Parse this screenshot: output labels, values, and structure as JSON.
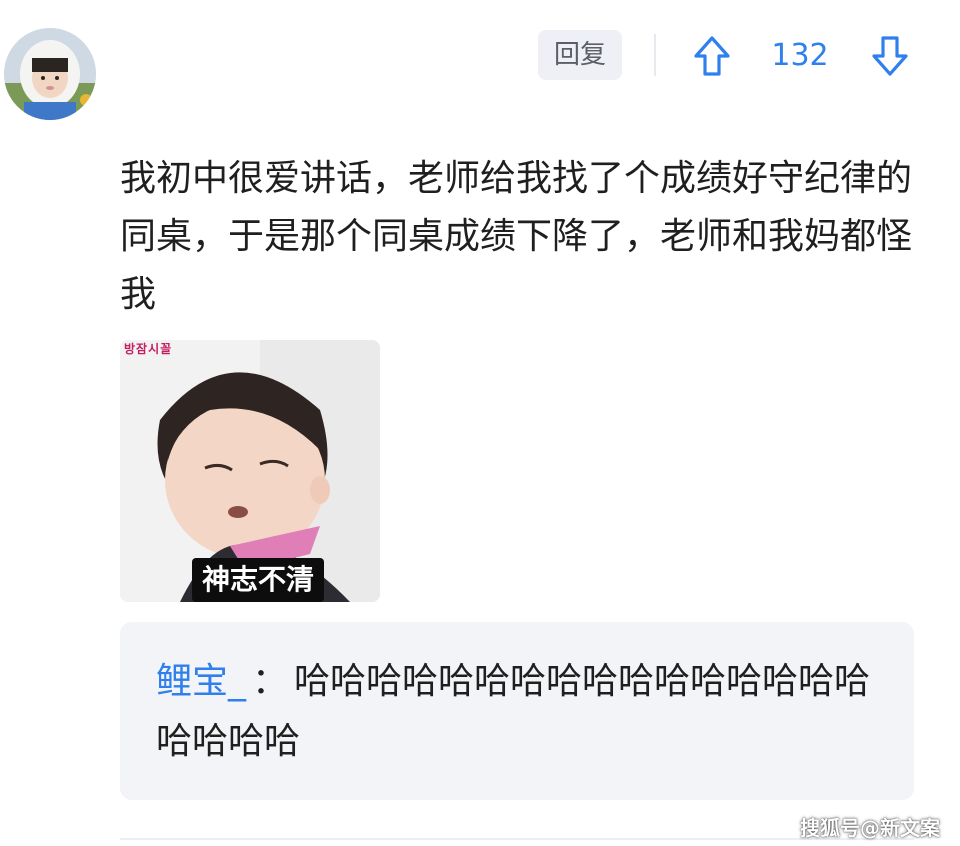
{
  "comment": {
    "actions": {
      "reply_label": "回复",
      "vote_count": "132"
    },
    "text": "我初中很爱讲话，老师给我找了个成绩好守纪律的同桌，于是那个同桌成绩下降了，老师和我妈都怪我",
    "meme": {
      "tag": "방잠시꼴",
      "caption": "神志不清"
    }
  },
  "reply": {
    "username": "鲤宝_",
    "separator": "：",
    "text": "哈哈哈哈哈哈哈哈哈哈哈哈哈哈哈哈哈哈哈哈"
  },
  "watermark": "搜狐号@新文案",
  "icons": {
    "upvote": "arrow-up-icon",
    "downvote": "arrow-down-icon",
    "avatar": "user-avatar"
  },
  "colors": {
    "accent": "#2f80ed",
    "reply_box_bg": "#f3f4f7",
    "reply_btn_bg": "#eef0f5"
  }
}
